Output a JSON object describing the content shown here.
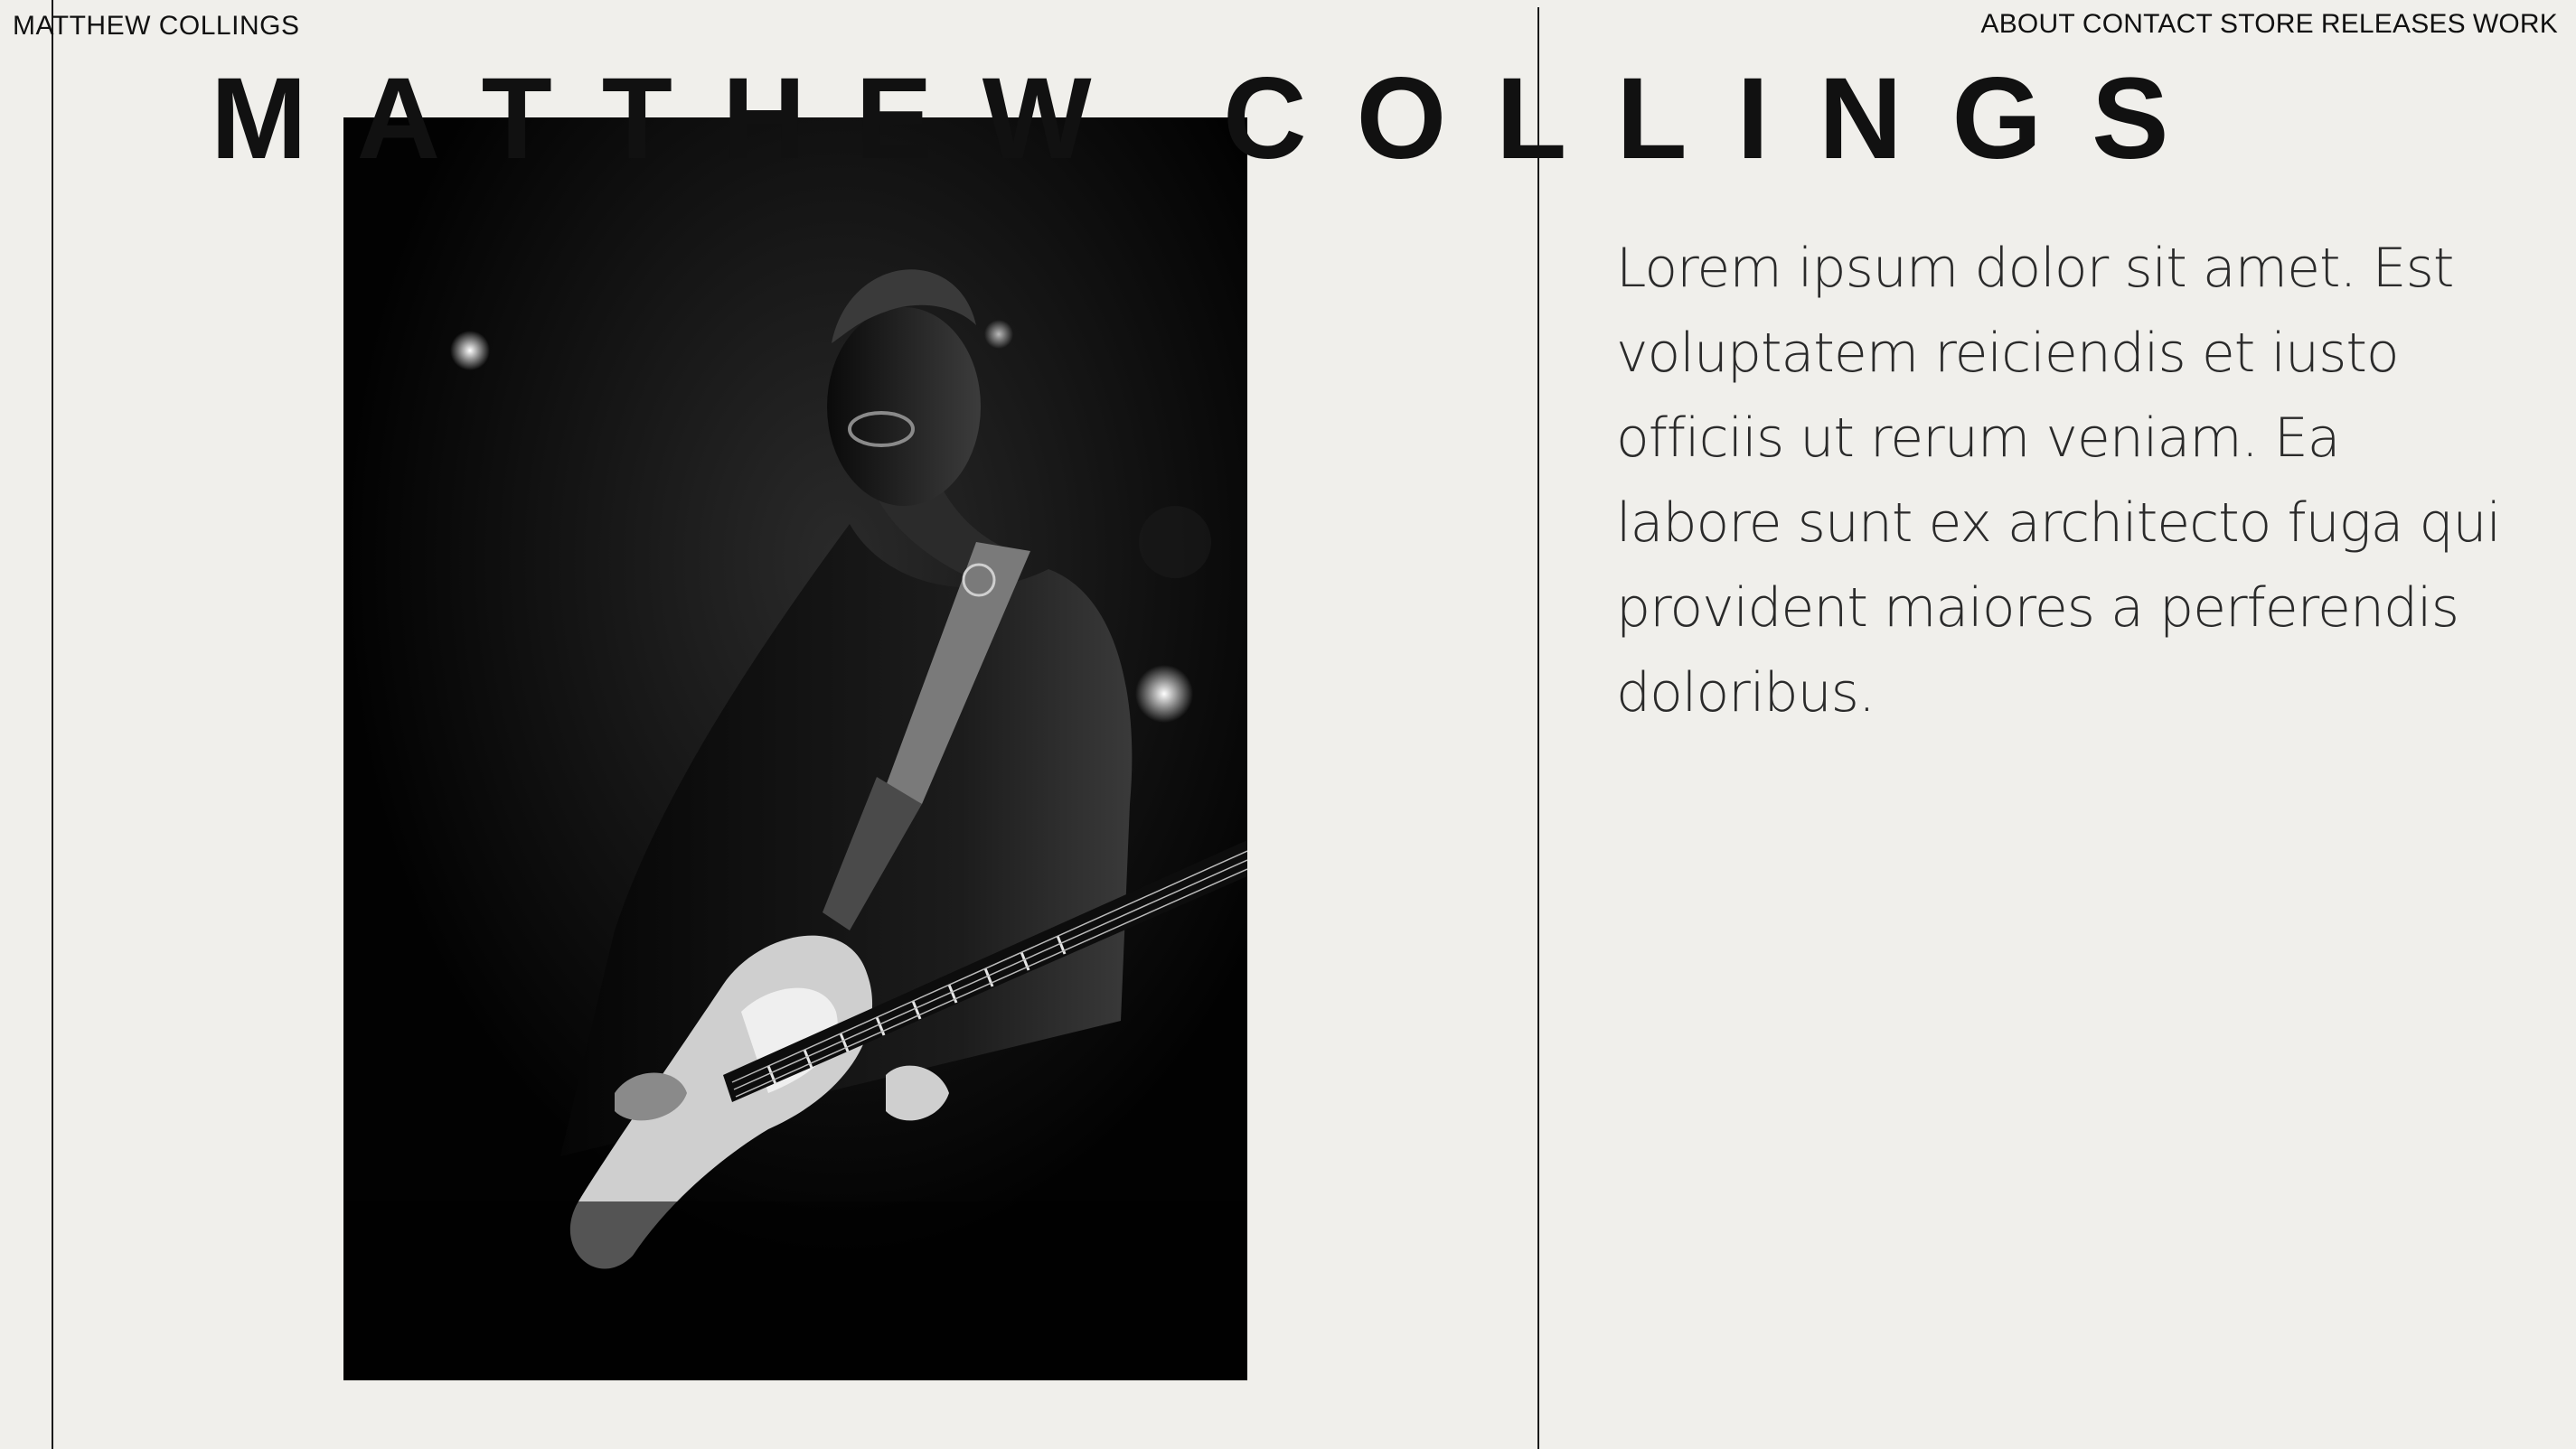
{
  "header": {
    "site_name": "MATTHEW COLLINGS",
    "nav": [
      "ABOUT",
      "CONTACT",
      "STORE",
      "RELEASES",
      "WORK"
    ]
  },
  "hero": {
    "headline": "MATTHEW COLLINGS",
    "photo_subject": "guitarist-performing-black-and-white"
  },
  "intro": {
    "text": "Lorem ipsum dolor sit amet. Est voluptatem reiciendis et iusto officiis ut rerum veniam. Ea labore sunt ex architecto fuga qui provident maiores a perferendis doloribus."
  },
  "colors": {
    "background": "#f0efeb",
    "text": "#111111",
    "photo_bg": "#020202"
  }
}
